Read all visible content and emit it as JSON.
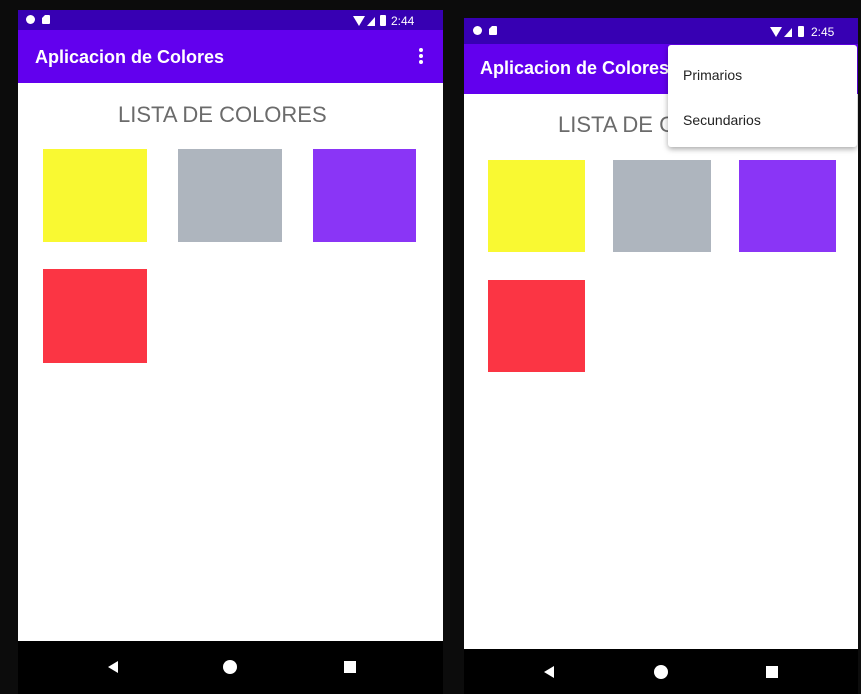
{
  "colors": {
    "status_bar": "#3700B3",
    "app_bar": "#6200EE",
    "background": "#FFFFFF",
    "nav_bar": "#000000",
    "heading_text": "#6B6B6B"
  },
  "screens": {
    "left": {
      "status_bar": {
        "time": "2:44"
      },
      "app_bar": {
        "title": "Aplicacion de Colores",
        "menu_icon": "overflow-menu-icon"
      },
      "heading": "LISTA DE COLORES",
      "swatches": [
        {
          "name": "yellow",
          "color": "#F9F932"
        },
        {
          "name": "gray",
          "color": "#AEB5BE"
        },
        {
          "name": "purple",
          "color": "#8A35F6"
        },
        {
          "name": "red",
          "color": "#FB3544"
        }
      ],
      "nav_bar": {
        "icons": [
          "back-icon",
          "home-icon",
          "recents-icon"
        ]
      }
    },
    "right": {
      "status_bar": {
        "time": "2:45"
      },
      "app_bar": {
        "title": "Aplicacion de Colores"
      },
      "heading": "LISTA DE COLORES",
      "menu": {
        "items": [
          "Primarios",
          "Secundarios"
        ]
      },
      "swatches": [
        {
          "name": "yellow",
          "color": "#F9F932"
        },
        {
          "name": "gray",
          "color": "#AEB5BE"
        },
        {
          "name": "purple",
          "color": "#8A35F6"
        },
        {
          "name": "red",
          "color": "#FB3544"
        }
      ],
      "nav_bar": {
        "icons": [
          "back-icon",
          "home-icon",
          "recents-icon"
        ]
      }
    }
  }
}
